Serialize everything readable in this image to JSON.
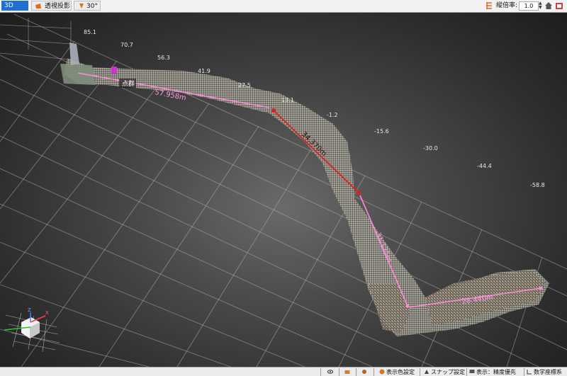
{
  "toolbar": {
    "tab_3d": "3D",
    "perspective_label": "透視投影",
    "angle_label": "30°",
    "scale_label": "縦倍率:",
    "scale_value": "1.0"
  },
  "viewport": {
    "elevation_labels": [
      "85.1",
      "70.7",
      "56.3",
      "41.9",
      "27.5",
      "13.1",
      "-1.2",
      "-15.6",
      "-30.0",
      "-44.4",
      "-58.8"
    ],
    "point_cloud_label": "点群",
    "measurements": [
      "57.958m",
      "34.370m",
      "31.125m",
      "28.440m"
    ],
    "axis_labels": {
      "z": "Z",
      "x": "X",
      "y": "Y"
    }
  },
  "statusbar": {
    "color_settings": "表示色設定",
    "snap_settings": "スナップ設定",
    "display_mode": "表示：精度優先",
    "coord_system": "数学座標系"
  },
  "colors": {
    "accent": "#1f6fd1",
    "measure_line": "#ff8ad8",
    "measure_red": "#e02020"
  },
  "icons": [
    "perspective-icon",
    "angle-icon",
    "scale-icon",
    "home-icon",
    "maximize-icon",
    "eye-icon",
    "camera-icon",
    "palette-icon",
    "snap-icon",
    "display-icon",
    "coord-icon"
  ]
}
